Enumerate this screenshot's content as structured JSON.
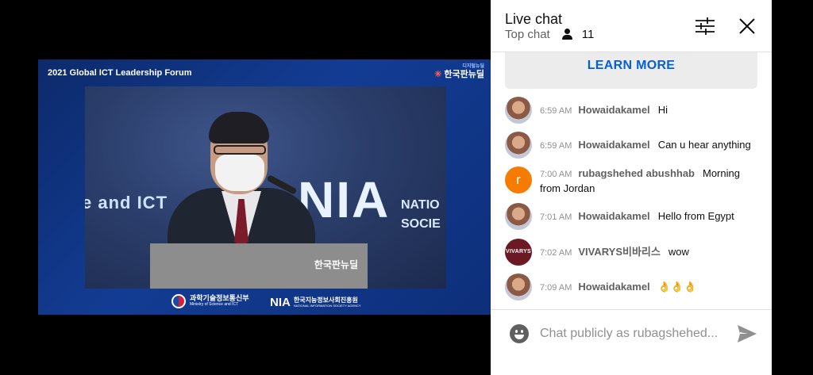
{
  "video": {
    "title": "2021 Global ICT Leadership Forum",
    "brand_small": "디지털뉴딜",
    "brand_main": "한국판뉴딜",
    "stage_left_text": "e and ICT",
    "stage_main_text": "NIA",
    "stage_side_line1": "NATIO",
    "stage_side_line2": "SOCIE",
    "podium_logo": "한국판뉴딜",
    "footer_gov": "과학기술정보통신부",
    "footer_gov_sub": "Ministry of Science and ICT",
    "footer_nia_mark": "NIA",
    "footer_nia_text": "한국지능정보사회진흥원",
    "footer_nia_sub": "NATIONAL INFORMATION SOCIETY AGENCY"
  },
  "chat": {
    "title": "Live chat",
    "mode": "Top chat",
    "viewer_count": "11",
    "learn_more": "LEARN MORE",
    "messages": [
      {
        "avatar": "photo",
        "time": "6:59 AM",
        "author": "Howaidakamel",
        "text": "Hi"
      },
      {
        "avatar": "photo",
        "time": "6:59 AM",
        "author": "Howaidakamel",
        "text": "Can u hear anything"
      },
      {
        "avatar": "letter",
        "avatar_letter": "r",
        "time": "7:00 AM",
        "author": "rubagshehed abushhab",
        "text": "Morning from Jordan"
      },
      {
        "avatar": "photo",
        "time": "7:01 AM",
        "author": "Howaidakamel",
        "text": "Hello from Egypt"
      },
      {
        "avatar": "brand",
        "avatar_label": "VIVARYS",
        "time": "7:02 AM",
        "author": "VIVARYS비바리스",
        "text": "wow"
      },
      {
        "avatar": "photo",
        "time": "7:09 AM",
        "author": "Howaidakamel",
        "text": "👌👌👌"
      }
    ],
    "input_placeholder": "Chat publicly as rubagshehed..."
  },
  "icons": {
    "filter": "filter-sliders-icon",
    "close": "close-icon",
    "viewer": "person-icon",
    "emoji": "emoji-icon",
    "send": "send-icon"
  },
  "colors": {
    "link_blue": "#065fd4",
    "avatar_orange": "#f57c00",
    "video_bg": "#123c93"
  }
}
